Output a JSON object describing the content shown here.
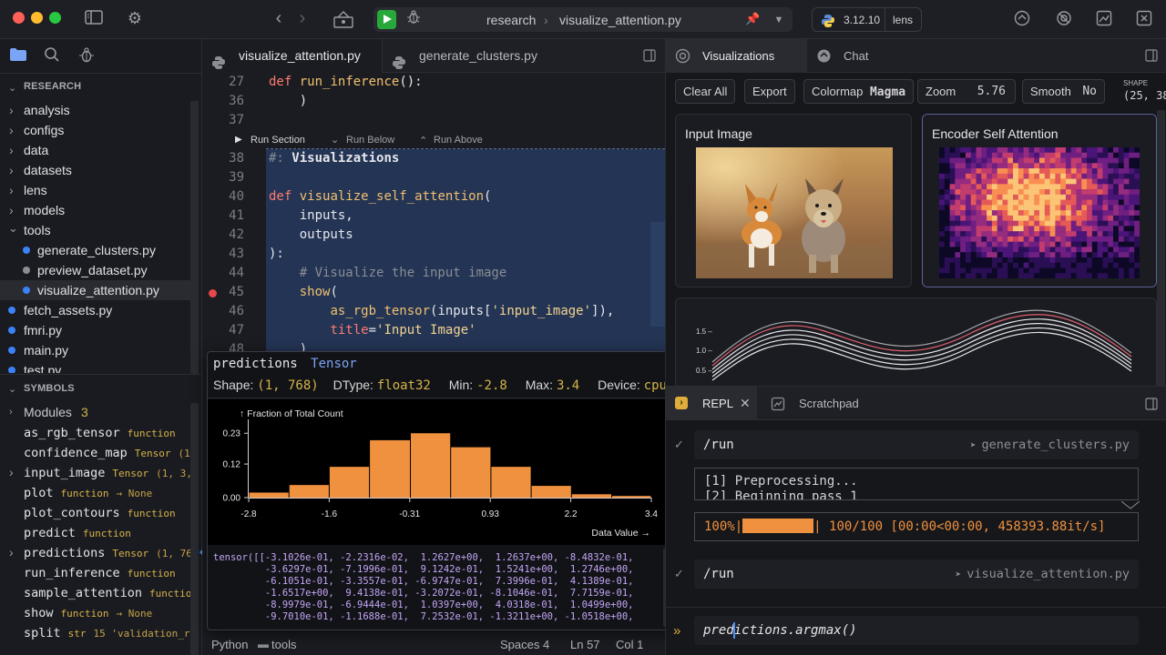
{
  "titlebar": {
    "breadcrumb_dir": "research",
    "breadcrumb_sep": "›",
    "breadcrumb_file": "visualize_attention.py",
    "python_version": "3.12.10",
    "env_name": "lens"
  },
  "sidebar": {
    "project_title": "RESEARCH",
    "tree": [
      {
        "label": "analysis",
        "kind": "folder"
      },
      {
        "label": "configs",
        "kind": "folder"
      },
      {
        "label": "data",
        "kind": "folder"
      },
      {
        "label": "datasets",
        "kind": "folder"
      },
      {
        "label": "lens",
        "kind": "folder"
      },
      {
        "label": "models",
        "kind": "folder"
      },
      {
        "label": "tools",
        "kind": "folder-open"
      },
      {
        "label": "generate_clusters.py",
        "kind": "file-child",
        "dot": "#3b82f6"
      },
      {
        "label": "preview_dataset.py",
        "kind": "file-child",
        "dot": "#8b8d95"
      },
      {
        "label": "visualize_attention.py",
        "kind": "file-child",
        "dot": "#3b82f6"
      },
      {
        "label": "fetch_assets.py",
        "kind": "file",
        "dot": "#3b82f6"
      },
      {
        "label": "fmri.py",
        "kind": "file",
        "dot": "#3b82f6"
      },
      {
        "label": "main.py",
        "kind": "file",
        "dot": "#3b82f6"
      },
      {
        "label": "test.py",
        "kind": "file",
        "dot": "#3b82f6"
      }
    ],
    "symbols_title": "SYMBOLS",
    "modules_label": "Modules",
    "modules_count": "3",
    "symbols": [
      {
        "name": "as_rgb_tensor",
        "kind": "function",
        "extra": "",
        "expandable": false
      },
      {
        "name": "confidence_map",
        "kind": "Tensor",
        "extra": "(1, 5",
        "expandable": false
      },
      {
        "name": "input_image",
        "kind": "Tensor",
        "extra": "(1, 3, 51",
        "expandable": true
      },
      {
        "name": "plot",
        "kind": "function",
        "extra": "→ None",
        "expandable": false
      },
      {
        "name": "plot_contours",
        "kind": "function",
        "extra": "",
        "expandable": false
      },
      {
        "name": "predict",
        "kind": "function",
        "extra": "",
        "expandable": false
      },
      {
        "name": "predictions",
        "kind": "Tensor",
        "extra": "(1, 768)",
        "expandable": true
      },
      {
        "name": "run_inference",
        "kind": "function",
        "extra": "",
        "expandable": false
      },
      {
        "name": "sample_attention",
        "kind": "function",
        "extra": "",
        "expandable": false
      },
      {
        "name": "show",
        "kind": "function",
        "extra": "→ None",
        "expandable": false
      },
      {
        "name": "split",
        "kind": "str",
        "extra": "15  'validation_re",
        "expandable": false
      }
    ]
  },
  "editor": {
    "tabs": [
      "visualize_attention.py",
      "generate_clusters.py"
    ],
    "lines_top": [
      {
        "n": "27",
        "html": "<span class='kw'>def</span> <span class='fn'>run_inference</span><span class='br'>():</span>"
      },
      {
        "n": "36",
        "html": "    <span class='br'>)</span>"
      },
      {
        "n": "37",
        "html": ""
      }
    ],
    "run_section": "Run Section",
    "run_below": "Run Below",
    "run_above": "Run Above",
    "lines": [
      {
        "n": "38",
        "html": "<span class='cm'>#:</span> <span class='var' style='font-weight:bold'>Visualizations</span>"
      },
      {
        "n": "39",
        "html": ""
      },
      {
        "n": "40",
        "html": "<span class='kw'>def</span> <span class='fn'>visualize_self_attention</span><span class='br'>(</span>"
      },
      {
        "n": "41",
        "html": "    <span class='var'>inputs,</span>"
      },
      {
        "n": "42",
        "html": "    <span class='var'>outputs</span>"
      },
      {
        "n": "43",
        "html": "<span class='br'>):</span>"
      },
      {
        "n": "44",
        "html": "    <span class='cm'># Visualize the input image</span>"
      },
      {
        "n": "45",
        "html": "    <span class='fn'>show</span><span class='br'>(</span>"
      },
      {
        "n": "46",
        "html": "        <span class='fn'>as_rgb_tensor</span><span class='br'>(</span><span class='var'>inputs[</span><span class='str'>'input_image'</span><span class='var'>]),</span>"
      },
      {
        "n": "47",
        "html": "        <span class='kw'>title</span><span class='var'>=</span><span class='str'>'Input Image'</span>"
      },
      {
        "n": "48",
        "html": "    <span class='br'>)</span>"
      }
    ],
    "status": {
      "language": "Python",
      "folder": "tools",
      "spaces": "Spaces 4",
      "line": "Ln 57",
      "col": "Col 1"
    }
  },
  "popup": {
    "name": "predictions",
    "type": "Tensor",
    "shape_label": "Shape:",
    "shape": "(1, 768)",
    "dtype_label": "DType:",
    "dtype": "float32",
    "min_label": "Min:",
    "min": "-2.8",
    "max_label": "Max:",
    "max": "3.4",
    "device_label": "Device:",
    "device": "cpu",
    "tensor_text": "tensor([[-3.1026e-01, -2.2316e-02,  1.2627e+00,  1.2637e+00, -8.4832e-01,\n         -3.6297e-01, -7.1996e-01,  9.1242e-01,  1.5241e+00,  1.2746e+00,\n         -6.1051e-01, -3.3557e-01, -6.9747e-01,  7.3996e-01,  4.1389e-01,\n         -1.6517e+00,  9.4138e-01, -3.2072e-01, -8.1046e-01,  7.7159e-01,\n         -8.9979e-01, -6.9444e-01,  1.0397e+00,  4.0318e-01,  1.0499e+00,\n         -9.7010e-01, -1.1688e-01,  7.2532e-01, -1.3211e+00, -1.0518e+00,"
  },
  "chart_data": {
    "type": "bar",
    "ylabel": "↑ Fraction of Total Count",
    "xlabel": "Data Value →",
    "x_ticks": [
      "-2.8",
      "-1.6",
      "-0.31",
      "0.93",
      "2.2",
      "3.4"
    ],
    "y_ticks": [
      "0.23",
      "0.12",
      "0.00"
    ],
    "bin_edges": [
      -2.8,
      -2.18,
      -1.56,
      -0.94,
      -0.31,
      0.31,
      0.93,
      1.55,
      2.17,
      2.79,
      3.4
    ],
    "values": [
      0.018,
      0.045,
      0.11,
      0.205,
      0.23,
      0.18,
      0.11,
      0.042,
      0.012,
      0.006
    ],
    "ylim": [
      0,
      0.26
    ],
    "color": "#f0913f"
  },
  "viz": {
    "tabs": [
      "Visualizations",
      "Chat"
    ],
    "buttons": {
      "clear": "Clear All",
      "export": "Export",
      "colormap_label": "Colormap",
      "colormap_value": "Magma",
      "zoom_label": "Zoom",
      "zoom_value": "5.76",
      "smooth_label": "Smooth",
      "smooth_value": "No"
    },
    "shape_label": "SHAPE",
    "shape_value": "(25, 38",
    "card1_title": "Input Image",
    "card2_title": "Encoder Self Attention",
    "contour_ticks": [
      "1.5 –",
      "1.0 –",
      "0.5 –"
    ]
  },
  "repl": {
    "tabs": [
      "REPL",
      "Scratchpad"
    ],
    "run1_cmd": "/run",
    "run1_file": "generate_clusters.py",
    "out_line1": "[1] Preprocessing...",
    "out_line2": "[2] Beginning pass 1",
    "progress_text": "100/100 [00:00<00:00, 458393.88it/s]",
    "progress_pct": "100%",
    "progress_fraction": 1.0,
    "run2_cmd": "/run",
    "run2_file": "visualize_attention.py",
    "input_value": "predictions.argmax()"
  }
}
